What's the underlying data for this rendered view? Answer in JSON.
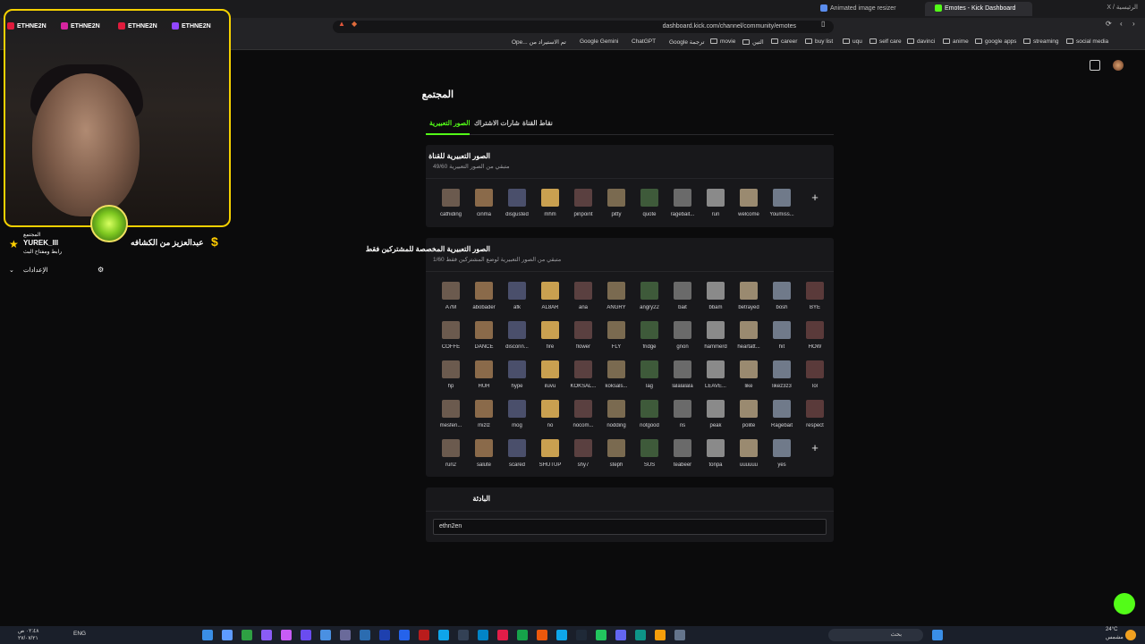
{
  "browser": {
    "tabs": [
      {
        "label": "Animated image resizer"
      },
      {
        "label": "Emotes - Kick Dashboard"
      }
    ],
    "window_title": "X / الرئيسية",
    "url": "dashboard.kick.com/channel/community/emotes",
    "bookmarks": [
      "Ope... تم الاستيراد من",
      "Google Gemini",
      "ChatGPT",
      "Google ترجمة",
      "movie",
      "التين",
      "career",
      "buy list",
      "uqu",
      "self care",
      "davinci",
      "anime",
      "google apps",
      "streaming",
      "social media"
    ]
  },
  "page": {
    "title": "المجتمع",
    "tabs": {
      "emotes": "الصور التعبيرية",
      "sub_badges": "شارات الاشتراك",
      "channel_points": "نقاط القناة"
    },
    "channel_emotes": {
      "title": "الصور التعبيرية للقناة",
      "subtitle": "49/60 متبقي من الصور التعبيرية",
      "items": [
        "cathiding",
        "cinma",
        "disgusted",
        "mhm",
        "pinpoint",
        "pitty",
        "quote",
        "ragebait...",
        "run",
        "welcome",
        "Youmiss..."
      ],
      "add_label": "+"
    },
    "sub_emotes": {
      "title": "الصور التعبيرية المخصصة للمشتركين فقط",
      "subtitle": "1/60 متبقي من الصور التعبيرية لوضع المشتركين فقط",
      "items": [
        "A7M",
        "abobader",
        "afk",
        "AL8AR",
        "ana",
        "ANGRY",
        "angry22",
        "bait",
        "bbam",
        "betrayed",
        "bosh",
        "BYE",
        "COFFE",
        "DANCE",
        "disconn...",
        "fire",
        "flower",
        "FLY",
        "fridge",
        "gnon",
        "hammerd",
        "heartatt...",
        "hit",
        "HOW",
        "hp",
        "HUH",
        "hype",
        "iluvu",
        "KOKSAL...",
        "koksals...",
        "lag",
        "lalalalala",
        "LEAVE...",
        "like",
        "likez3z3",
        "lol",
        "mesferi...",
        "mizlz",
        "mog",
        "no",
        "nocom...",
        "nodding",
        "notgood",
        "ns",
        "peak",
        "polite",
        "Ragebait",
        "respect",
        "run2",
        "salute",
        "scared",
        "SHUTUP",
        "shy7",
        "steph",
        "SUS",
        "teabeer",
        "tonpa",
        "uuuuuu",
        "yes"
      ],
      "add_label": "+"
    },
    "identity": {
      "title": "البادئة",
      "value": "ethn2en"
    }
  },
  "stream_overlay": {
    "tags": [
      "ETHNE2N",
      "ETHNE2N",
      "ETHNE2N",
      "ETHNE2N"
    ],
    "community_label": "المجتمع",
    "username": "YUREK_III",
    "link_label": "رابط ومفتاح البث",
    "settings_label": "الإعدادات",
    "donation_text": "عبدالعزيز من الكشافه"
  },
  "taskbar": {
    "time": "٠٢:٤٨ ص",
    "date": "٢٧/٠٧/٢١",
    "lang": "ENG",
    "search_placeholder": "بحث",
    "weather": "24°C",
    "weather_desc": "مشمس"
  },
  "colors": {
    "accent": "#53fc18",
    "card": "#18181b",
    "background": "#0b0b0c",
    "frame": "#f5d100"
  }
}
